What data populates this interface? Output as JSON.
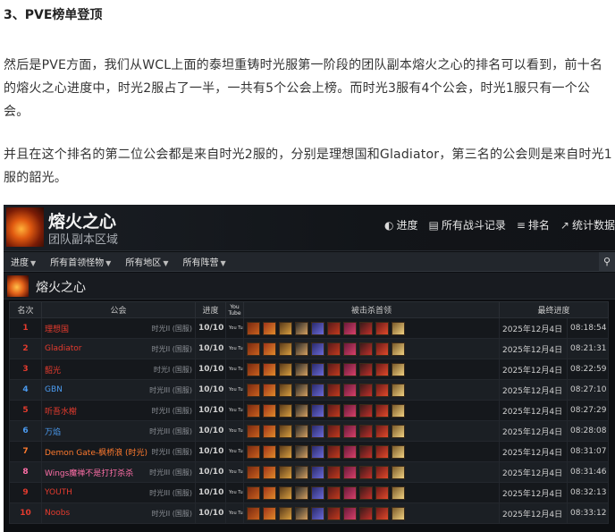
{
  "article": {
    "section_title": "3、PVE榜单登顶",
    "paragraph1": "然后是PVE方面，我们从WCL上面的泰坦重铸时光服第一阶段的团队副本熔火之心的排名可以看到，前十名的熔火之心进度中，时光2服占了一半，一共有5个公会上榜。而时光3服有4个公会，时光1服只有一个公会。",
    "paragraph2": "并且在这个排名的第二位公会都是来自时光2服的，分别是理想国和Gladiator，第三名的公会则是来自时光1服的韶光。"
  },
  "embed": {
    "banner": {
      "title": "熔火之心",
      "subtitle": "团队副本区域",
      "nav": [
        {
          "icon": "◐",
          "label": "进度"
        },
        {
          "icon": "▤",
          "label": "所有战斗记录"
        },
        {
          "icon": "≡",
          "label": "排名"
        },
        {
          "icon": "↗",
          "label": "统计数据"
        }
      ]
    },
    "filters": [
      "进度",
      "所有首领怪物",
      "所有地区",
      "所有阵营"
    ],
    "zone_title": "熔火之心",
    "table": {
      "headers": {
        "rank": "名次",
        "guild": "公会",
        "progress": "进度",
        "video": "You Tube",
        "bosses": "被击杀首领",
        "final": "最终进度"
      },
      "rows": [
        {
          "rank": "1",
          "guild": "理想国",
          "server": "时光II (国服)",
          "progress": "10/10",
          "yt": "You Tube",
          "date": "2025年12月4日",
          "time": "08:18:54",
          "color": "#e53b2e"
        },
        {
          "rank": "2",
          "guild": "Gladiator",
          "server": "时光II (国服)",
          "progress": "10/10",
          "yt": "You Tube",
          "date": "2025年12月4日",
          "time": "08:21:31",
          "color": "#e53b2e"
        },
        {
          "rank": "3",
          "guild": "韶光",
          "server": "时光I (国服)",
          "progress": "10/10",
          "yt": "You Tube",
          "date": "2025年12月4日",
          "time": "08:22:59",
          "color": "#e53b2e"
        },
        {
          "rank": "4",
          "guild": "GBN",
          "server": "时光III (国服)",
          "progress": "10/10",
          "yt": "You Tube",
          "date": "2025年12月4日",
          "time": "08:27:10",
          "color": "#4b9bf0"
        },
        {
          "rank": "5",
          "guild": "听吾水榭",
          "server": "时光II (国服)",
          "progress": "10/10",
          "yt": "You Tube",
          "date": "2025年12月4日",
          "time": "08:27:29",
          "color": "#e53b2e"
        },
        {
          "rank": "6",
          "guild": "万焰",
          "server": "时光III (国服)",
          "progress": "10/10",
          "yt": "You Tube",
          "date": "2025年12月4日",
          "time": "08:28:08",
          "color": "#4b9bf0"
        },
        {
          "rank": "7",
          "guild": "Demon Gate-枫桥浪 (时光)",
          "server": "时光II (国服)",
          "progress": "10/10",
          "yt": "You Tube",
          "date": "2025年12月4日",
          "time": "08:31:07",
          "color": "#ff7a2e"
        },
        {
          "rank": "8",
          "guild": "Wings魔禅不是打打杀杀",
          "server": "时光III (国服)",
          "progress": "10/10",
          "yt": "You Tube",
          "date": "2025年12月4日",
          "time": "08:31:46",
          "color": "#ff6fa8"
        },
        {
          "rank": "9",
          "guild": "YOUTH",
          "server": "时光III (国服)",
          "progress": "10/10",
          "yt": "You Tube",
          "date": "2025年12月4日",
          "time": "08:32:13",
          "color": "#e53b2e"
        },
        {
          "rank": "10",
          "guild": "Noobs",
          "server": "时光II (国服)",
          "progress": "10/10",
          "yt": "You Tube",
          "date": "2025年12月4日",
          "time": "08:33:12",
          "color": "#e53b2e"
        }
      ],
      "boss_icons": [
        "lucifron-icon",
        "magmadar-icon",
        "gehennas-icon",
        "garr-icon",
        "shazzrah-icon",
        "baron-geddon-icon",
        "sulfuron-icon",
        "golemagg-icon",
        "majordomo-icon",
        "ragnaros-icon"
      ]
    }
  }
}
